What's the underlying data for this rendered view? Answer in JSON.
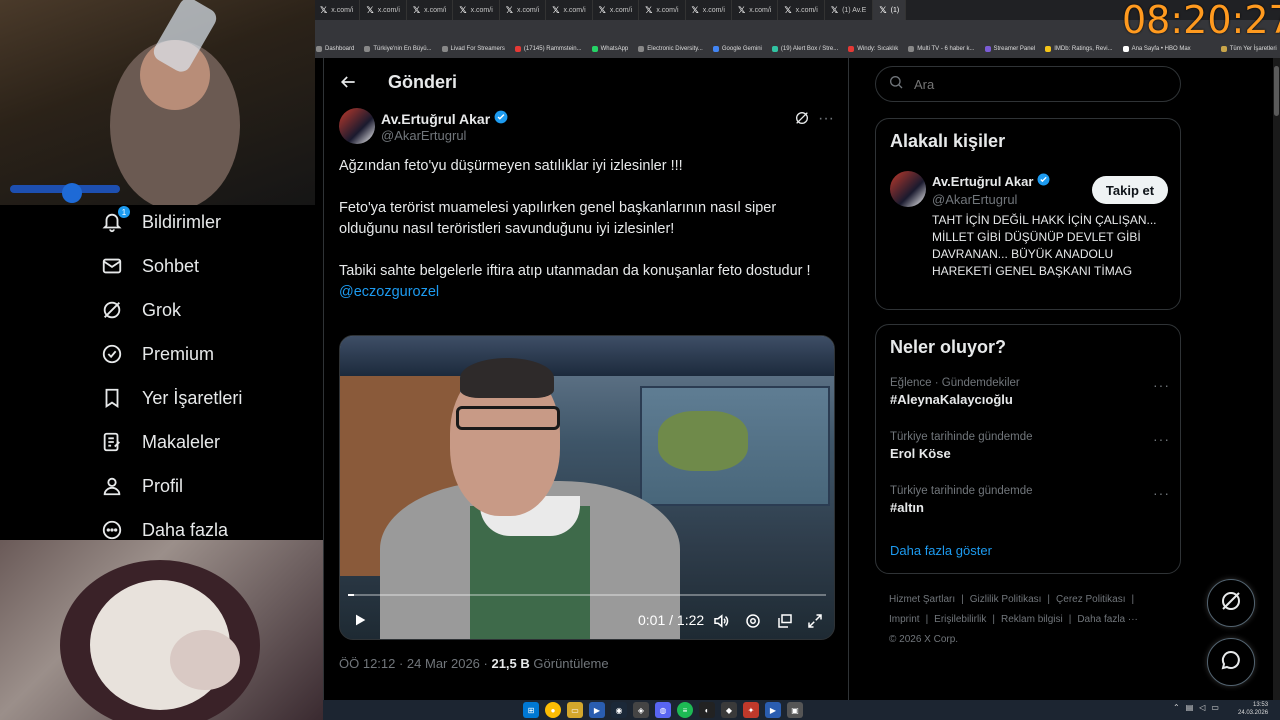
{
  "browser": {
    "tabs": [
      {
        "label": "x.com/i"
      },
      {
        "label": "x.com/i"
      },
      {
        "label": "x.com/i"
      },
      {
        "label": "x.com/i"
      },
      {
        "label": "x.com/i"
      },
      {
        "label": "x.com/i"
      },
      {
        "label": "x.com/i"
      },
      {
        "label": "x.com/i"
      },
      {
        "label": "x.com/i"
      },
      {
        "label": "x.com/i"
      },
      {
        "label": "x.com/i"
      },
      {
        "label": "(1) Av.E"
      },
      {
        "label": "(1)"
      }
    ],
    "bookmarks": [
      "Dashboard",
      "Türkiye'nin En Büyü...",
      "Livad For Streamers",
      "(17145) Rammstein...",
      "WhatsApp",
      "Electronic Diversity...",
      "Google Gemini",
      "(19) Alert Box / Stre...",
      "Windy: Sıcaklık",
      "Multi TV - 6 haber k...",
      "Streamer Panel",
      "IMDb: Ratings, Revi...",
      "Ana Sayfa • HBO Max",
      "Tüm Yer İşaretleri"
    ]
  },
  "overlay": {
    "clock": "08:20:27"
  },
  "nav": {
    "items": [
      {
        "label": "Bildirimler",
        "icon": "bell-icon",
        "badge": "1"
      },
      {
        "label": "Sohbet",
        "icon": "envelope-icon"
      },
      {
        "label": "Grok",
        "icon": "grok-icon"
      },
      {
        "label": "Premium",
        "icon": "verified-badge-icon"
      },
      {
        "label": "Yer İşaretleri",
        "icon": "bookmark-icon"
      },
      {
        "label": "Makaleler",
        "icon": "article-icon"
      },
      {
        "label": "Profil",
        "icon": "person-icon"
      },
      {
        "label": "Daha fazla",
        "icon": "more-circle-icon"
      }
    ]
  },
  "post": {
    "header_title": "Gönderi",
    "author_name": "Av.Ertuğrul Akar",
    "author_handle": "@AkarErtugrul",
    "text_1": "Ağzından feto'yu düşürmeyen satılıklar iyi izlesinler !!!",
    "text_2": "Feto'ya terörist muamelesi yapılırken genel başkanlarının nasıl siper olduğunu nasıl teröristleri savunduğunu iyi izlesinler!",
    "text_3": "Tabiki sahte belgelerle iftira atıp utanmadan da konuşanlar feto dostudur !",
    "mention": "@eczozgurozel",
    "video_time": "0:01 / 1:22",
    "video_progress": 0.012,
    "meta_time": "ÖÖ 12:12 · 24 Mar 2026 · ",
    "views": "21,5 B",
    "views_label": " Görüntüleme"
  },
  "search": {
    "placeholder": "Ara"
  },
  "related": {
    "title": "Alakalı kişiler",
    "name": "Av.Ertuğrul Akar",
    "handle": "@AkarErtugrul",
    "follow_label": "Takip et",
    "bio": "TAHT İÇİN DEĞİL HAKK İÇİN ÇALIŞAN... MİLLET GİBİ DÜŞÜNÜP DEVLET GİBİ DAVRANAN... BÜYÜK ANADOLU HAREKETİ GENEL BAŞKANI TİMAG"
  },
  "trends": {
    "title": "Neler oluyor?",
    "items": [
      {
        "context": "Eğlence · Gündemdekiler",
        "name": "#AleynaKalaycıoğlu"
      },
      {
        "context": "Türkiye tarihinde gündemde",
        "name": "Erol Köse"
      },
      {
        "context": "Türkiye tarihinde gündemde",
        "name": "#altın"
      }
    ],
    "show_more": "Daha fazla göster"
  },
  "footer": {
    "links": [
      "Hizmet Şartları",
      "|",
      "Gizlilik Politikası",
      "|",
      "Çerez Politikası",
      "|",
      "Imprint",
      "|",
      "Erişilebilirlik",
      "|",
      "Reklam bilgisi",
      "|",
      "Daha fazla ···"
    ],
    "copyright": "© 2026 X Corp."
  },
  "taskbar": {
    "time": "13:53",
    "date": "24.03.2026"
  },
  "colors": {
    "accent": "#1d9bf0",
    "clock": "#ff9a1f",
    "background": "#000000",
    "border": "#2f3336",
    "muted": "#71767b"
  }
}
